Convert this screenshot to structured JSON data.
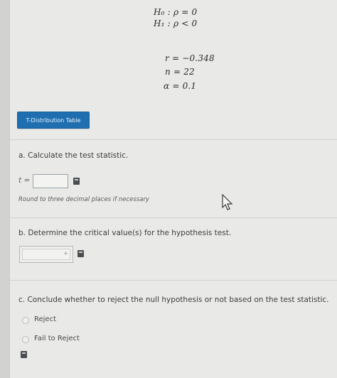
{
  "hypotheses": {
    "h0": "H₀ : ρ = 0",
    "h1": "H₁ : ρ < 0"
  },
  "given": {
    "r": "r = −0.348",
    "n": "n = 22",
    "alpha": "α = 0.1"
  },
  "table_button": "T-Distribution Table",
  "part_a": {
    "question": "a. Calculate the test statistic.",
    "prefix": "t =",
    "value": "",
    "note": "Round to three decimal places if necessary"
  },
  "part_b": {
    "question": "b. Determine the critical value(s) for the hypothesis test.",
    "value": "",
    "plus_sign": "+"
  },
  "part_c": {
    "question": "c. Conclude whether to reject the null hypothesis or not based on the test statistic.",
    "options": [
      "Reject",
      "Fail to Reject"
    ]
  }
}
